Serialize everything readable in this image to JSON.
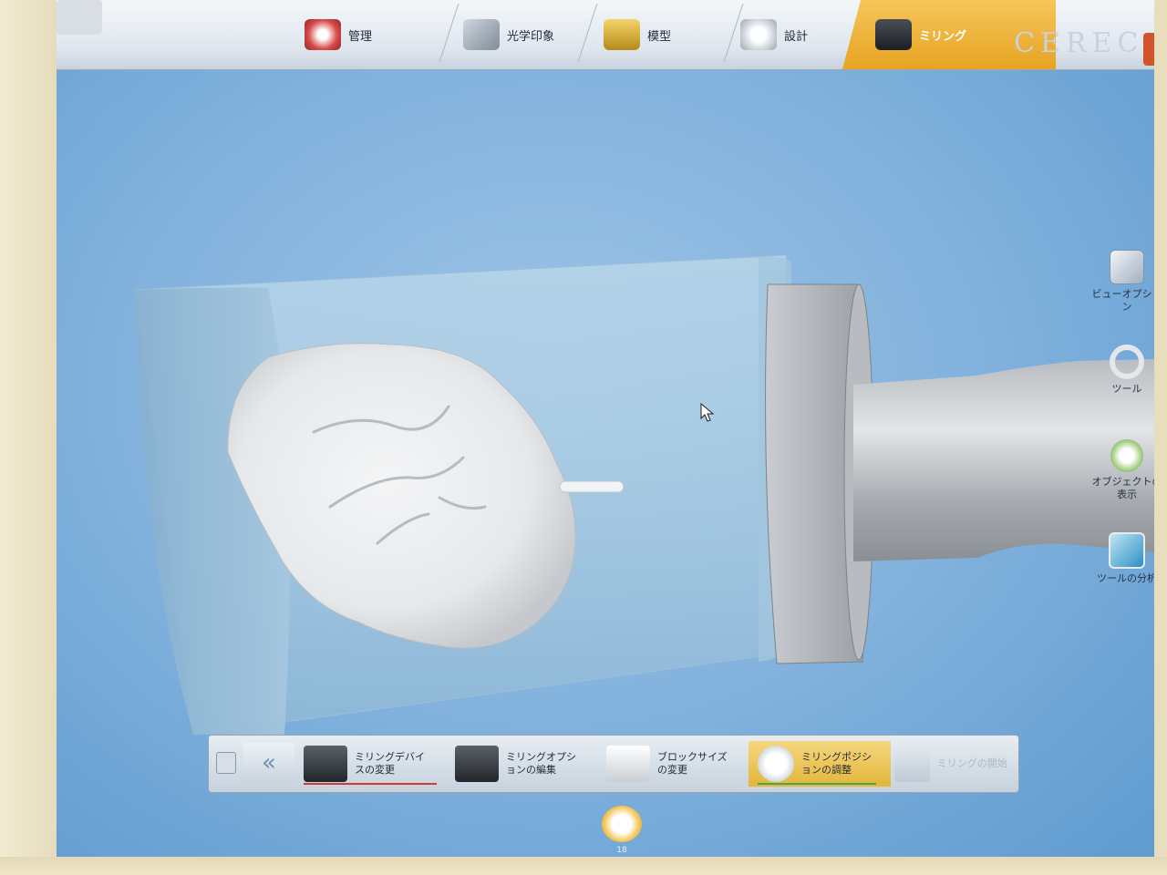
{
  "topbar": {
    "steps": [
      {
        "label": "管理",
        "icon": "dentures-icon"
      },
      {
        "label": "光学印象",
        "icon": "scanner-camera-icon"
      },
      {
        "label": "模型",
        "icon": "model-icon"
      },
      {
        "label": "設計",
        "icon": "crown-design-icon"
      },
      {
        "label": "ミリング",
        "icon": "milling-unit-icon"
      }
    ],
    "active_step": "ミリング",
    "brand": "CEREC"
  },
  "side_tools": [
    {
      "label": "ビューオプション",
      "icon": "view-options-icon"
    },
    {
      "label": "ツール",
      "icon": "tool-ring-icon"
    },
    {
      "label": "オブジェクトの表示",
      "icon": "object-display-icon"
    },
    {
      "label": "ツールの分析",
      "icon": "tool-analysis-icon"
    }
  ],
  "bottom_steps": [
    {
      "label": "ミリングデバイスの変更",
      "icon": "milling-device-icon"
    },
    {
      "label": "ミリングオプションの編集",
      "icon": "milling-options-icon"
    },
    {
      "label": "ブロックサイズの変更",
      "icon": "block-size-icon"
    },
    {
      "label": "ミリングポジションの調整",
      "icon": "milling-position-icon"
    },
    {
      "label": "ミリングの開始",
      "icon": "start-milling-icon"
    }
  ],
  "case": {
    "number": "18"
  },
  "colors": {
    "accent": "#e6a422",
    "screen_bg": "#7fb0dc",
    "underline_red": "#d23a3a",
    "underline_green": "#49a94a"
  }
}
